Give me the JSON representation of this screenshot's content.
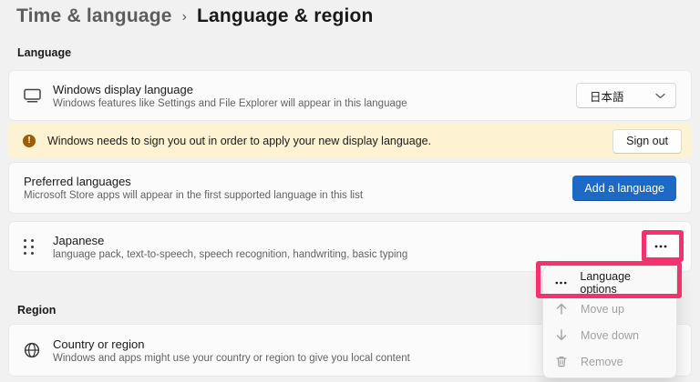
{
  "breadcrumb": {
    "parent": "Time & language",
    "separator": "›",
    "current": "Language & region"
  },
  "language_section": {
    "label": "Language"
  },
  "region_section": {
    "label": "Region"
  },
  "cards": {
    "display_language": {
      "title": "Windows display language",
      "description": "Windows features like Settings and File Explorer will appear in this language",
      "dropdown_value": "日本語"
    },
    "signout_banner": {
      "message": "Windows needs to sign you out in order to apply your new display language.",
      "button_label": "Sign out"
    },
    "preferred_languages": {
      "title": "Preferred languages",
      "description": "Microsoft Store apps will appear in the first supported language in this list",
      "button_label": "Add a language"
    },
    "japanese_language": {
      "title": "Japanese",
      "description": "language pack, text-to-speech, speech recognition, handwriting, basic typing"
    },
    "country_region": {
      "title": "Country or region",
      "description": "Windows and apps might use your country or region to give you local content"
    }
  },
  "context_menu": {
    "items": [
      {
        "label": "Language options",
        "icon": "more-icon",
        "enabled": true
      },
      {
        "label": "Move up",
        "icon": "arrow-up-icon",
        "enabled": false
      },
      {
        "label": "Move down",
        "icon": "arrow-down-icon",
        "enabled": false
      },
      {
        "label": "Remove",
        "icon": "trash-icon",
        "enabled": false
      }
    ]
  },
  "colors": {
    "accent_blue": "#1e68c8",
    "annotation_pink": "#f4326e",
    "banner_background": "#fdf3d2",
    "warning_icon_color": "#9d5d00"
  }
}
